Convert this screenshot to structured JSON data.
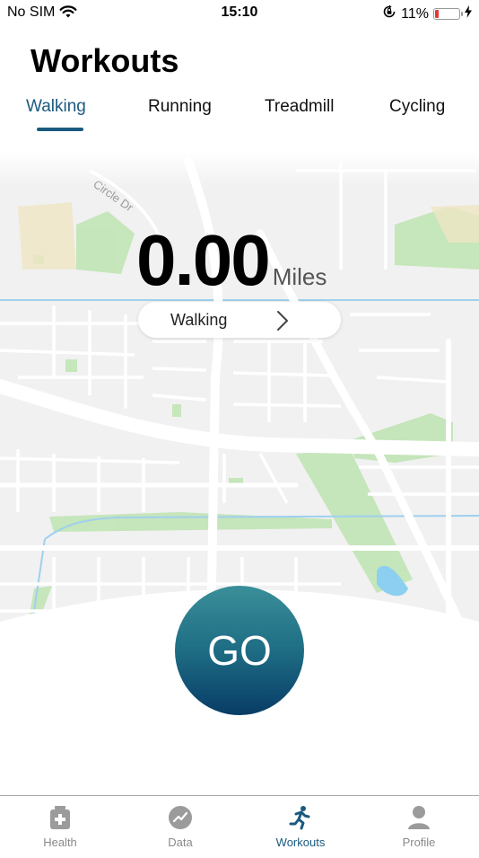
{
  "status_bar": {
    "carrier": "No SIM",
    "time": "15:10",
    "battery_percent": "11%",
    "battery_level": 0.11
  },
  "page_title": "Workouts",
  "tabs": [
    {
      "label": "Walking",
      "active": true
    },
    {
      "label": "Running",
      "active": false
    },
    {
      "label": "Treadmill",
      "active": false
    },
    {
      "label": "Cycling",
      "active": false
    }
  ],
  "map": {
    "street_label": "Circle Dr"
  },
  "distance": {
    "value": "0.00",
    "unit": "Miles"
  },
  "workout_type": {
    "label": "Walking"
  },
  "go_button": {
    "label": "GO"
  },
  "bottom_nav": [
    {
      "label": "Health",
      "icon": "health-kit-icon"
    },
    {
      "label": "Data",
      "icon": "chart-trend-icon"
    },
    {
      "label": "Workouts",
      "icon": "runner-icon",
      "active": true
    },
    {
      "label": "Profile",
      "icon": "person-icon"
    }
  ],
  "colors": {
    "accent": "#1b5a7e",
    "go_top": "#3a8f99",
    "go_bottom": "#083c66",
    "battery_low": "#e53935"
  }
}
